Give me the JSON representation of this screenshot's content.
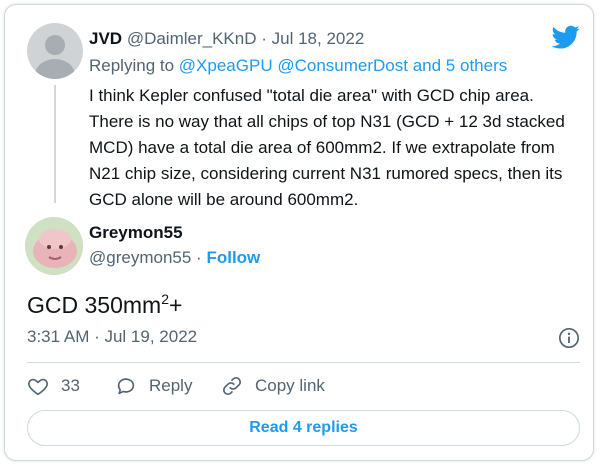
{
  "colors": {
    "accent": "#1d9bf0",
    "muted": "#536471",
    "text": "#0f1419",
    "border": "#cfd9de"
  },
  "icons": {
    "brand": "twitter-bird-icon",
    "info": "info-icon",
    "like": "heart-icon",
    "reply": "reply-bubble-icon",
    "copy": "link-icon"
  },
  "parent_tweet": {
    "author_name": "JVD",
    "author_handle": "@Daimler_KKnD",
    "separator": "·",
    "date": "Jul 18, 2022",
    "replying_label": "Replying to",
    "mention_1": "@XpeaGPU",
    "mention_2": "@ConsumerDost",
    "others": "and 5 others",
    "body": "I think Kepler confused \"total die area\" with GCD chip area. There is no way that all chips of top N31 (GCD + 12 3d stacked MCD) have a total die area of 600mm2. If we extrapolate from N21 chip size, considering current N31 rumored specs, then its GCD alone will be around 600mm2."
  },
  "main_tweet": {
    "author_name": "Greymon55",
    "author_handle": "@greymon55",
    "separator": "·",
    "follow_label": "Follow",
    "text_main": "GCD 350mm",
    "text_sup": "2",
    "text_tail": "+",
    "timestamp": "3:31 AM · Jul 19, 2022"
  },
  "actions": {
    "like_count": "33",
    "reply_label": "Reply",
    "copy_label": "Copy link"
  },
  "read_replies_label": "Read 4 replies"
}
